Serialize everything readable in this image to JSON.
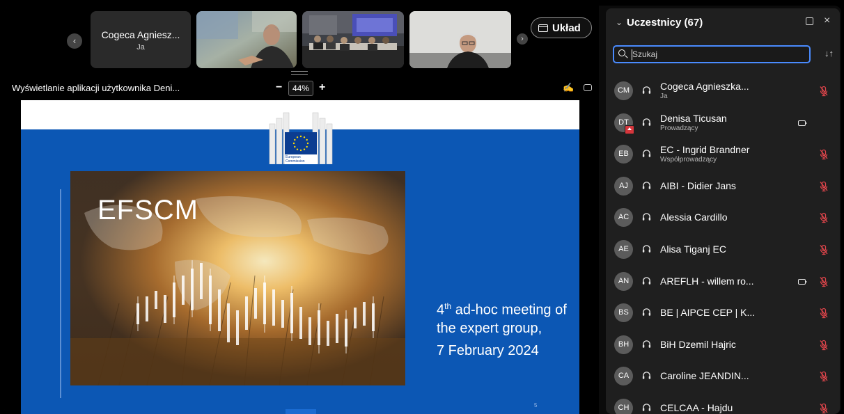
{
  "filmstrip": {
    "prev_icon": "chevron-left-icon",
    "next_icon": "chevron-right-icon",
    "self_name": "Cogeca Agniesz...",
    "self_label": "Ja",
    "layout_button": "Układ"
  },
  "share": {
    "title": "Wyświetlanie aplikacji użytkownika Deni...",
    "zoom_minus": "−",
    "zoom_value": "44%",
    "zoom_plus": "+"
  },
  "slide": {
    "logo_text_1": "European",
    "logo_text_2": "Commission",
    "image_title": "EFSCM",
    "title_line1_num": "4",
    "title_line1_sup": "th",
    "title_line1_rest": " ad-hoc meeting of",
    "title_line2": "the expert group,",
    "title_line3": "7 February 2024",
    "page_number": "5",
    "brand_color": "#0c57b4"
  },
  "panel": {
    "title": "Uczestnicy (67)",
    "search_placeholder": "Szukaj",
    "participants": [
      {
        "initials": "CM",
        "name": "Cogeca Agnieszka...",
        "role": "Ja",
        "camera": false,
        "muted": true,
        "sharing": false
      },
      {
        "initials": "DT",
        "name": "Denisa Ticusan",
        "role": "Prowadzący",
        "camera": true,
        "muted": false,
        "sharing": true
      },
      {
        "initials": "EB",
        "name": "EC - Ingrid Brandner",
        "role": "Współprowadzący",
        "camera": false,
        "muted": true,
        "sharing": false
      },
      {
        "initials": "AJ",
        "name": "AIBI - Didier Jans",
        "role": "",
        "camera": false,
        "muted": true,
        "sharing": false
      },
      {
        "initials": "AC",
        "name": "Alessia Cardillo",
        "role": "",
        "camera": false,
        "muted": true,
        "sharing": false
      },
      {
        "initials": "AE",
        "name": "Alisa Tiganj EC",
        "role": "",
        "camera": false,
        "muted": true,
        "sharing": false
      },
      {
        "initials": "AN",
        "name": "AREFLH - willem ro...",
        "role": "",
        "camera": true,
        "muted": true,
        "sharing": false
      },
      {
        "initials": "BS",
        "name": "BE | AIPCE CEP | K...",
        "role": "",
        "camera": false,
        "muted": true,
        "sharing": false
      },
      {
        "initials": "BH",
        "name": "BiH Dzemil Hajric",
        "role": "",
        "camera": false,
        "muted": true,
        "sharing": false
      },
      {
        "initials": "CA",
        "name": "Caroline JEANDIN...",
        "role": "",
        "camera": false,
        "muted": true,
        "sharing": false
      },
      {
        "initials": "CH",
        "name": "CELCAA - Hajdu",
        "role": "",
        "camera": false,
        "muted": true,
        "sharing": false
      }
    ]
  },
  "colors": {
    "accent": "#4a8bff",
    "muted_red": "#e0454b",
    "panel_bg": "#1f1f1f"
  }
}
